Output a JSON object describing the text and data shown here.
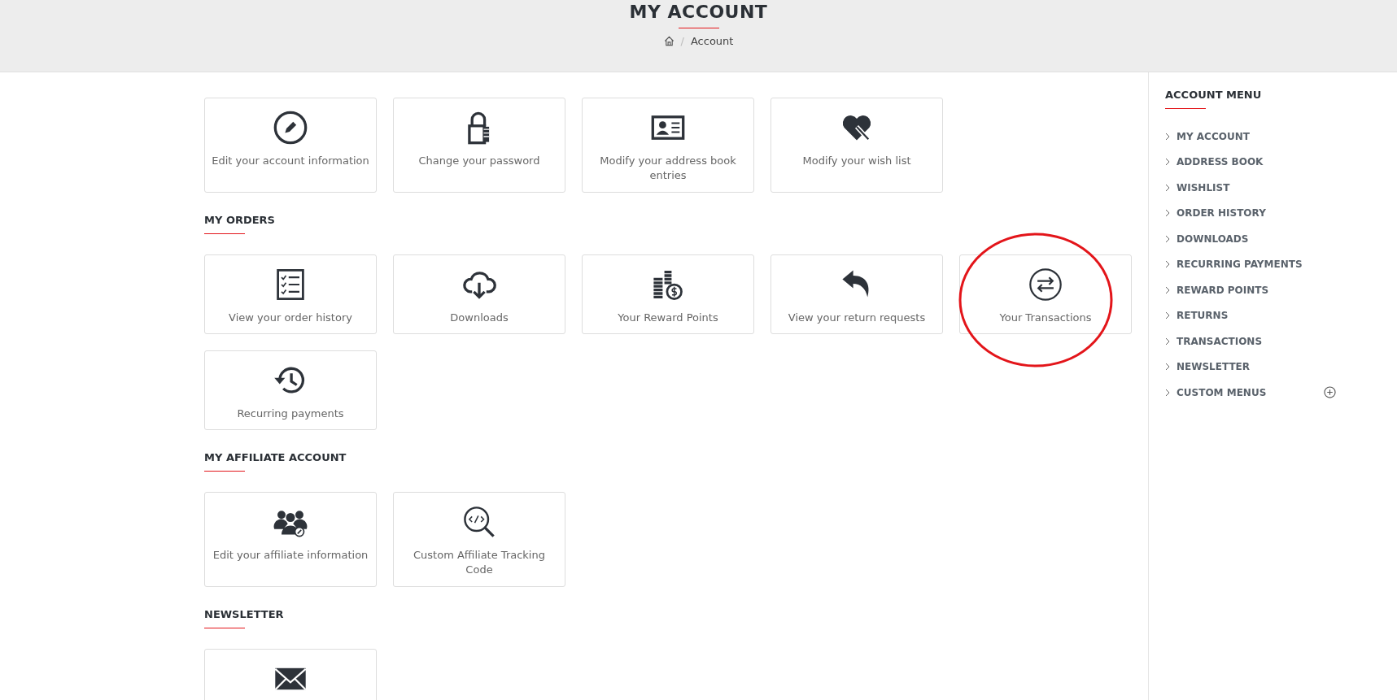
{
  "header": {
    "title": "MY ACCOUNT",
    "separator": "/",
    "breadcrumb": [
      "Account"
    ]
  },
  "sections": [
    {
      "tall": true,
      "items": [
        {
          "label": "Edit your account information",
          "circled": false
        },
        {
          "label": "Change your password",
          "circled": false
        },
        {
          "label": "Modify your address book entries",
          "circled": false
        },
        {
          "label": "Modify your wish list",
          "circled": false
        }
      ]
    },
    {
      "title": "MY ORDERS",
      "tall": false,
      "items": [
        {
          "label": "View your order history",
          "circled": false
        },
        {
          "label": "Downloads",
          "circled": false
        },
        {
          "label": "Your Reward Points",
          "circled": false
        },
        {
          "label": "View your return requests",
          "circled": false
        },
        {
          "label": "Your Transactions",
          "circled": true
        },
        {
          "label": "Recurring payments",
          "circled": false
        }
      ]
    },
    {
      "title": "MY AFFILIATE ACCOUNT",
      "tall": true,
      "items": [
        {
          "label": "Edit your affiliate information",
          "circled": false
        },
        {
          "label": "Custom Affiliate Tracking Code",
          "circled": false
        }
      ]
    },
    {
      "title": "NEWSLETTER",
      "items": [
        {
          "circled": false
        }
      ]
    }
  ],
  "sidebar": {
    "title": "ACCOUNT MENU",
    "items": [
      {
        "label": "MY ACCOUNT",
        "expandable": false
      },
      {
        "label": "ADDRESS BOOK",
        "expandable": false
      },
      {
        "label": "WISHLIST",
        "expandable": false
      },
      {
        "label": "ORDER HISTORY",
        "expandable": false
      },
      {
        "label": "DOWNLOADS",
        "expandable": false
      },
      {
        "label": "RECURRING PAYMENTS",
        "expandable": false
      },
      {
        "label": "REWARD POINTS",
        "expandable": false
      },
      {
        "label": "RETURNS",
        "expandable": false
      },
      {
        "label": "TRANSACTIONS",
        "expandable": false
      },
      {
        "label": "NEWSLETTER",
        "expandable": false
      },
      {
        "label": "CUSTOM MENUS",
        "expandable": true
      }
    ]
  }
}
